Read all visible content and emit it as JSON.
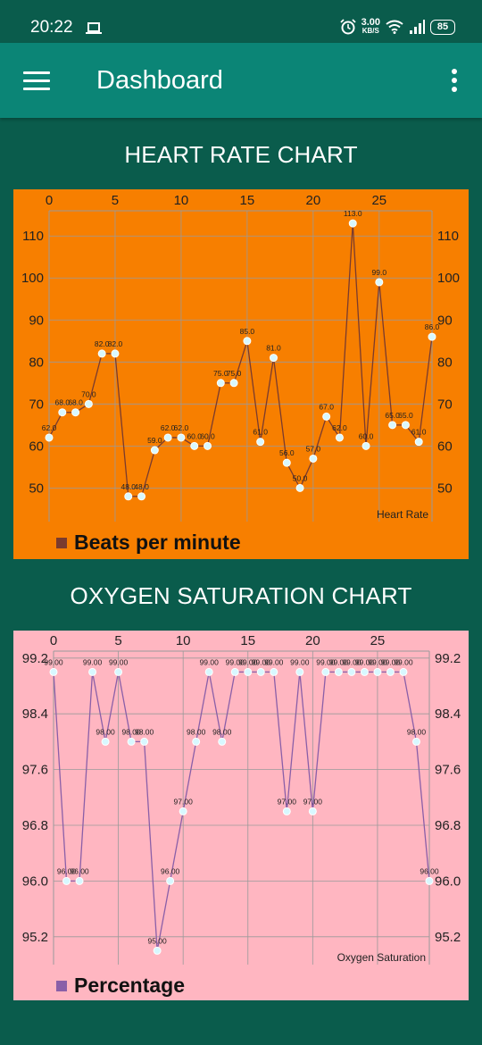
{
  "status": {
    "time": "20:22",
    "speed_value": "3.00",
    "speed_unit": "KB/S",
    "battery": "85"
  },
  "appbar": {
    "title": "Dashboard"
  },
  "heart_section": {
    "title": "HEART RATE CHART",
    "legend": "Beats per minute",
    "description": "Heart Rate",
    "background": "#f77f00",
    "line_color": "#7a3b2e"
  },
  "oxygen_section": {
    "title": "OXYGEN SATURATION CHART",
    "legend": "Percentage",
    "description": "Oxygen Saturation",
    "background": "#ffb6c1",
    "line_color": "#8a5fa8"
  },
  "chart_data": [
    {
      "type": "line",
      "x_ticks": [
        0,
        5,
        10,
        15,
        20,
        25
      ],
      "y_ticks": [
        50,
        60,
        70,
        80,
        90,
        100,
        110
      ],
      "xlim": [
        0,
        29
      ],
      "ylim": [
        42,
        116
      ],
      "value_labels": [
        "62.0",
        "68.0",
        "68.0",
        "70.0",
        "82.0",
        "82.0",
        "48.0",
        "48.0",
        "59.0",
        "62.0",
        "62.0",
        "60.0",
        "60.0",
        "75.0",
        "75.0",
        "85.0",
        "61.0",
        "81.0",
        "56.0",
        "50.0",
        "57.0",
        "67.0",
        "62.0",
        "113.0",
        "60.0",
        "99.0",
        "65.0",
        "65.0",
        "61.0",
        "86.0"
      ],
      "series": [
        {
          "name": "Beats per minute",
          "x": [
            0,
            1,
            2,
            3,
            4,
            5,
            6,
            7,
            8,
            9,
            10,
            11,
            12,
            13,
            14,
            15,
            16,
            17,
            18,
            19,
            20,
            21,
            22,
            23,
            24,
            25,
            26,
            27,
            28,
            29
          ],
          "values": [
            62,
            68,
            68,
            70,
            82,
            82,
            48,
            48,
            59,
            62,
            62,
            60,
            60,
            75,
            75,
            85,
            61,
            81,
            56,
            50,
            57,
            67,
            62,
            113,
            60,
            99,
            65,
            65,
            61,
            86
          ]
        }
      ]
    },
    {
      "type": "line",
      "x_ticks": [
        0,
        5,
        10,
        15,
        20,
        25
      ],
      "y_ticks": [
        95.2,
        96.0,
        96.8,
        97.6,
        98.4,
        99.2
      ],
      "y_tick_labels": [
        "95.2",
        "96.0",
        "96.8",
        "97.6",
        "98.4",
        "99.2"
      ],
      "xlim": [
        0,
        29
      ],
      "ylim": [
        94.8,
        99.3
      ],
      "value_labels": [
        "99.00",
        "96.00",
        "96.00",
        "99.00",
        "98.00",
        "99.00",
        "98.00",
        "98.00",
        "95.00",
        "96.00",
        "97.00",
        "98.00",
        "99.00",
        "98.00",
        "99.00",
        "99.00",
        "99.00",
        "99.00",
        "97.00",
        "99.00",
        "97.00",
        "99.00",
        "99.00",
        "99.00",
        "99.00",
        "99.00",
        "99.00",
        "99.00",
        "98.00",
        "96.00"
      ],
      "series": [
        {
          "name": "Percentage",
          "x": [
            0,
            1,
            2,
            3,
            4,
            5,
            6,
            7,
            8,
            9,
            10,
            11,
            12,
            13,
            14,
            15,
            16,
            17,
            18,
            19,
            20,
            21,
            22,
            23,
            24,
            25,
            26,
            27,
            28,
            29
          ],
          "values": [
            99,
            96,
            96,
            99,
            98,
            99,
            98,
            98,
            95,
            96,
            97,
            98,
            99,
            98,
            99,
            99,
            99,
            99,
            97,
            99,
            97,
            99,
            99,
            99,
            99,
            99,
            99,
            99,
            98,
            96
          ]
        }
      ]
    }
  ]
}
